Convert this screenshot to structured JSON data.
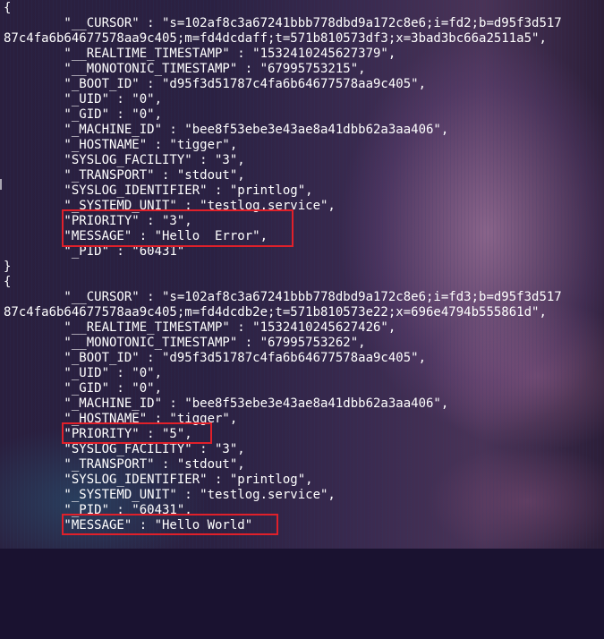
{
  "terminal": {
    "lines": [
      "{",
      "        \"__CURSOR\" : \"s=102af8c3a67241bbb778dbd9a172c8e6;i=fd2;b=d95f3d517",
      "87c4fa6b64677578aa9c405;m=fd4dcdaff;t=571b810573df3;x=3bad3bc66a2511a5\",",
      "        \"__REALTIME_TIMESTAMP\" : \"1532410245627379\",",
      "        \"__MONOTONIC_TIMESTAMP\" : \"67995753215\",",
      "        \"_BOOT_ID\" : \"d95f3d51787c4fa6b64677578aa9c405\",",
      "        \"_UID\" : \"0\",",
      "        \"_GID\" : \"0\",",
      "        \"_MACHINE_ID\" : \"bee8f53ebe3e43ae8a41dbb62a3aa406\",",
      "        \"_HOSTNAME\" : \"tigger\",",
      "        \"SYSLOG_FACILITY\" : \"3\",",
      "        \"_TRANSPORT\" : \"stdout\",",
      "        \"SYSLOG_IDENTIFIER\" : \"printlog\",",
      "        \"_SYSTEMD_UNIT\" : \"testlog.service\",",
      "        \"PRIORITY\" : \"3\",",
      "        \"MESSAGE\" : \"Hello  Error\",",
      "        \"_PID\" : \"60431\"",
      "}",
      "{",
      "        \"__CURSOR\" : \"s=102af8c3a67241bbb778dbd9a172c8e6;i=fd3;b=d95f3d517",
      "87c4fa6b64677578aa9c405;m=fd4dcdb2e;t=571b810573e22;x=696e4794b555861d\",",
      "        \"__REALTIME_TIMESTAMP\" : \"1532410245627426\",",
      "        \"__MONOTONIC_TIMESTAMP\" : \"67995753262\",",
      "        \"_BOOT_ID\" : \"d95f3d51787c4fa6b64677578aa9c405\",",
      "        \"_UID\" : \"0\",",
      "        \"_GID\" : \"0\",",
      "        \"_MACHINE_ID\" : \"bee8f53ebe3e43ae8a41dbb62a3aa406\",",
      "        \"_HOSTNAME\" : \"tigger\",",
      "        \"PRIORITY\" : \"5\",",
      "        \"SYSLOG_FACILITY\" : \"3\",",
      "        \"_TRANSPORT\" : \"stdout\",",
      "        \"SYSLOG_IDENTIFIER\" : \"printlog\",",
      "        \"_SYSTEMD_UNIT\" : \"testlog.service\",",
      "        \"_PID\" : \"60431\",",
      "        \"MESSAGE\" : \"Hello World\""
    ]
  },
  "colors": {
    "text": "#ffffff",
    "highlight": "#e0202a"
  }
}
